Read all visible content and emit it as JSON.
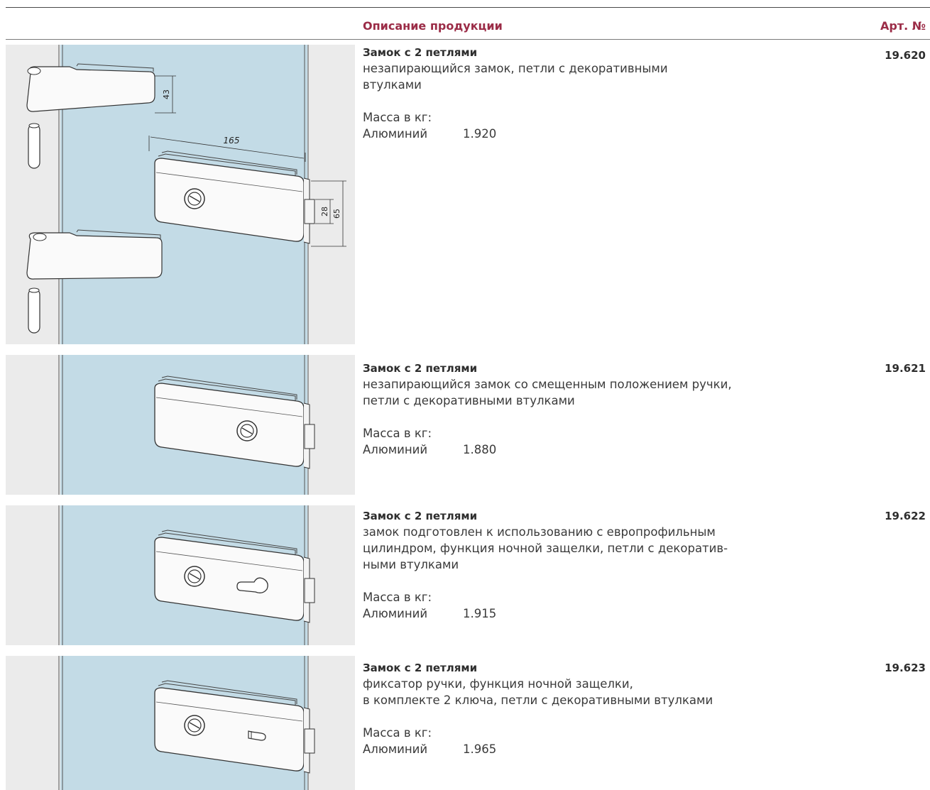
{
  "header": {
    "description_label": "Описание продукции",
    "article_label": "Арт. №"
  },
  "colors": {
    "accent": "#9b2c47",
    "glass": "#c3dbe6",
    "panel": "#ebebeb"
  },
  "products": [
    {
      "title": "Замок с 2 петлями",
      "description_lines": [
        "незапирающийся замок, петли с декоративными",
        "втулками"
      ],
      "mass_label": "Масса в кг:",
      "material": "Алюминий",
      "weight": "1.920",
      "article": "19.620",
      "dimensions": {
        "hinge_height": "43",
        "lock_length": "165",
        "strike_height": "28",
        "lock_height": "65"
      }
    },
    {
      "title": "Замок с 2 петлями",
      "description_lines": [
        "незапирающийся замок со смещенным положением ручки,",
        "петли с декоративными втулками"
      ],
      "mass_label": "Масса в кг:",
      "material": "Алюминий",
      "weight": "1.880",
      "article": "19.621"
    },
    {
      "title": "Замок с 2 петлями",
      "description_lines": [
        "замок подготовлен к использованию с европрофильным",
        "цилиндром, функция ночной защелки, петли с декоратив-",
        "ными втулками"
      ],
      "mass_label": "Масса в кг:",
      "material": "Алюминий",
      "weight": "1.915",
      "article": "19.622"
    },
    {
      "title": "Замок с 2 петлями",
      "description_lines": [
        "фиксатор ручки, функция ночной защелки,",
        "в комплекте 2 ключа, петли с декоративными втулками"
      ],
      "mass_label": "Масса в кг:",
      "material": "Алюминий",
      "weight": "1.965",
      "article": "19.623"
    }
  ]
}
